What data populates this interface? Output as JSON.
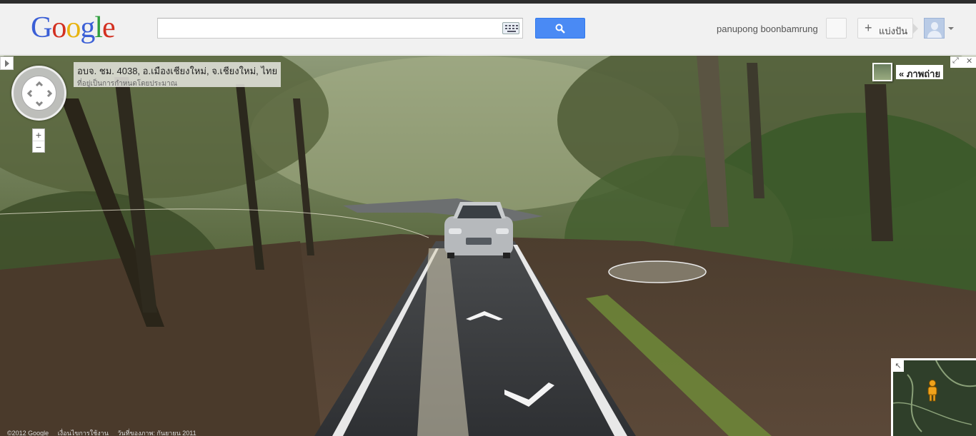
{
  "header": {
    "logo_letters": [
      {
        "ch": "G",
        "color": "#3b5fd6"
      },
      {
        "ch": "o",
        "color": "#d33020"
      },
      {
        "ch": "o",
        "color": "#e8b30f"
      },
      {
        "ch": "g",
        "color": "#3b5fd6"
      },
      {
        "ch": "l",
        "color": "#2f9e3e"
      },
      {
        "ch": "e",
        "color": "#d33020"
      }
    ],
    "search_value": "",
    "username": "panupong boonbamrung",
    "share_label": "แบ่งปัน"
  },
  "streetview": {
    "address": "อบจ. ชม. 4038, อ.เมืองเชียงใหม่, จ.เชียงใหม่, ไทย",
    "address_note": "ที่อยู่เป็นการกำหนดโดยประมาณ",
    "photos_label": "« ภาพถ่าย",
    "zoom_in": "+",
    "zoom_out": "−",
    "footer": [
      "©2012 Google",
      "เงื่อนไขการใช้งาน",
      "วันที่ของภาพ: กันยายน 2011"
    ]
  },
  "colors": {
    "accent_blue": "#4a8af4",
    "header_bg": "#f1f1f1"
  },
  "icons": [
    "keyboard-icon",
    "search-icon",
    "plus-icon",
    "avatar-icon",
    "pan-control-icon",
    "pegman-icon",
    "fullscreen-icon",
    "close-icon"
  ]
}
